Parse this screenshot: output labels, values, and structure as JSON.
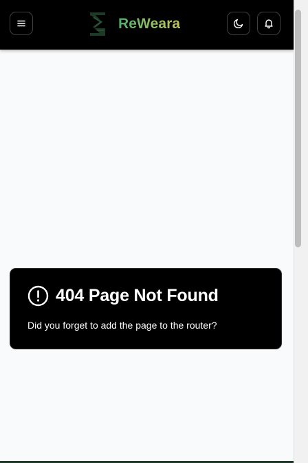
{
  "header": {
    "brand_name": "ReWeara",
    "menu_icon": "hamburger-menu-icon",
    "theme_icon": "moon-icon",
    "notifications_icon": "bell-icon",
    "logo_icon": "rewera-leaf-s-logo"
  },
  "error": {
    "icon": "exclamation-circle-icon",
    "title": "404 Page Not Found",
    "message": "Did you forget to add the page to the router?"
  },
  "colors": {
    "header_bg": "#000000",
    "page_bg": "#f9fafb",
    "brand_gradient_start": "#4caf6b",
    "brand_gradient_end": "#c6c25a",
    "card_bg": "#000000",
    "card_text": "#ffffff"
  }
}
